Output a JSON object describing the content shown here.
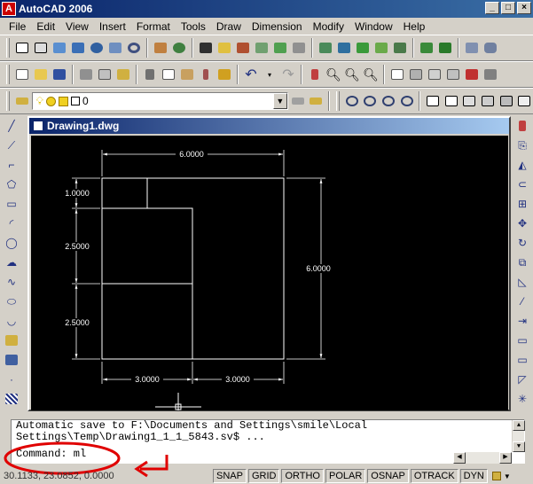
{
  "app": {
    "title": "AutoCAD 2006",
    "icon": "A"
  },
  "menu": [
    "File",
    "Edit",
    "View",
    "Insert",
    "Format",
    "Tools",
    "Draw",
    "Dimension",
    "Modify",
    "Window",
    "Help"
  ],
  "layer": {
    "name": "0"
  },
  "document": {
    "title": "Drawing1.dwg"
  },
  "drawing": {
    "dims": {
      "top_width": "6.0000",
      "right_height": "6.0000",
      "left_top": "1.0000",
      "left_mid": "2.5000",
      "left_bot": "2.5000",
      "bottom_left": "3.0000",
      "bottom_right": "3.0000"
    }
  },
  "command": {
    "lines": [
      "Automatic save to F:\\Documents and Settings\\smile\\Local",
      "Settings\\Temp\\Drawing1_1_1_5843.sv$ ..."
    ],
    "prompt": "Command: ml"
  },
  "status": {
    "coords": "30.1133, 23.0852, 0.0000",
    "buttons": [
      "SNAP",
      "GRID",
      "ORTHO",
      "POLAR",
      "OSNAP",
      "OTRACK",
      "DYN"
    ]
  },
  "colors": {
    "title_bar": "#0a246a",
    "canvas": "#000000",
    "annotation": "#e00000"
  }
}
